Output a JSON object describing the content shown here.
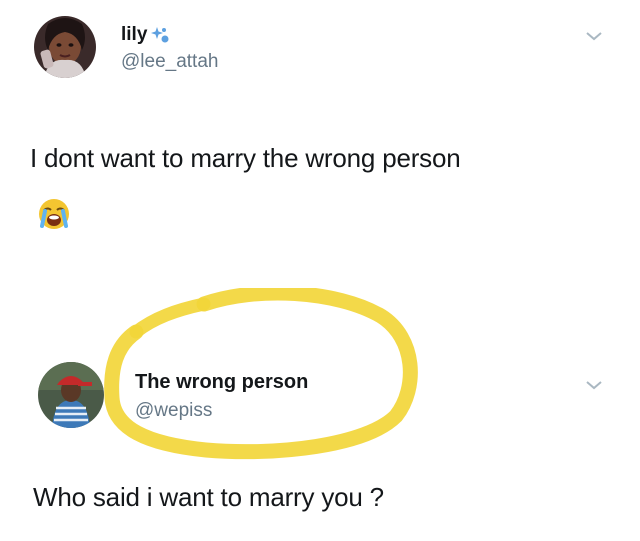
{
  "tweets": [
    {
      "display_name": "lily",
      "handle": "@lee_attah",
      "text": "I dont want to marry the wrong person",
      "name_emoji": "sparkles-icon",
      "body_emoji": "loudly-crying-face-icon",
      "avatar": "user-avatar-icon",
      "menu_icon": "chevron-down-icon"
    },
    {
      "display_name": "The wrong person",
      "handle": "@wepiss",
      "text": "Who said i want to marry you ?",
      "avatar": "user-avatar-icon",
      "menu_icon": "chevron-down-icon",
      "annotation": "yellow-circle-highlight",
      "annotation_color": "#f2d63a"
    }
  ],
  "colors": {
    "text": "#14171a",
    "secondary_text": "#657786",
    "highlight": "#f2d63a",
    "background": "#ffffff"
  }
}
